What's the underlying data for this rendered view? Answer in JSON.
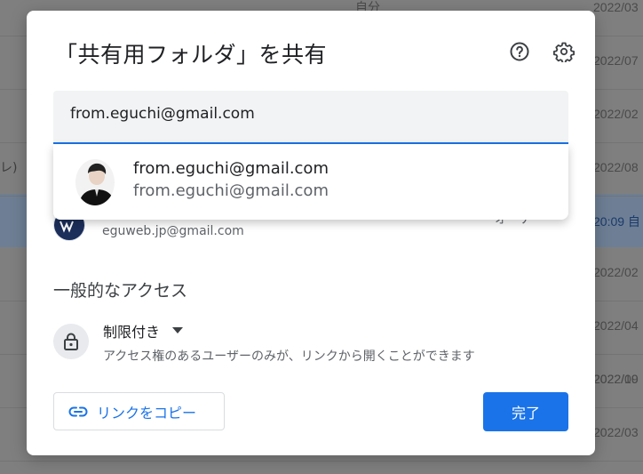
{
  "background": {
    "owner_text": "自分",
    "left_fragment": "レ)",
    "dates": [
      "2022/03",
      "2022/07",
      "2022/02",
      "2022/08",
      "20:09 自",
      "2022/02",
      "2022/04",
      "2022/09",
      "2022/10",
      "2022/03"
    ]
  },
  "dialog": {
    "title": "「共有用フォルダ」を共有",
    "help_icon": "help-circle-icon",
    "settings_icon": "gear-icon"
  },
  "search": {
    "value": "from.eguchi@gmail.com"
  },
  "suggestion": {
    "name": "from.eguchi@gmail.com",
    "email": "from.eguchi@gmail.com"
  },
  "people": {
    "owner_email": "eguweb.jp@gmail.com",
    "owner_role": "オーナー"
  },
  "general_access": {
    "label": "一般的なアクセス",
    "level": "制限付き",
    "description": "アクセス権のあるユーザーのみが、リンクから開くことができます"
  },
  "buttons": {
    "copy_link": "リンクをコピー",
    "done": "完了"
  },
  "colors": {
    "accent": "#1a73e8",
    "scrim": "#7f7f7f"
  }
}
